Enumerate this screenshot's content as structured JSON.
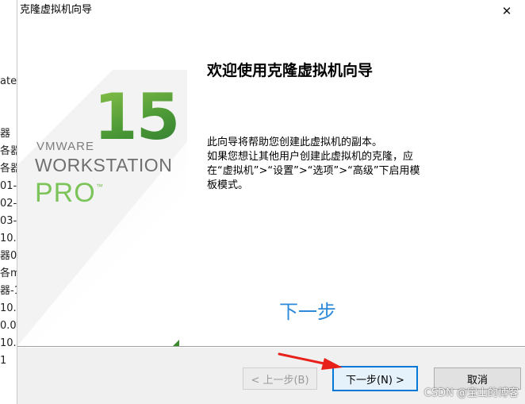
{
  "background_window": {
    "fragments": [
      "ate",
      "器",
      "各器",
      "各器",
      "01-",
      "02-",
      "03-",
      "10.",
      "器01",
      "各m",
      "器-1",
      "10.",
      "0.0.",
      "10.",
      "1"
    ]
  },
  "dialog": {
    "title": "克隆虚拟机向导",
    "close_icon": "✕"
  },
  "banner": {
    "version": "15",
    "brand": "VMWARE",
    "product": "WORKSTATION",
    "edition": "PRO",
    "trademark": "™"
  },
  "content": {
    "heading": "欢迎使用克隆虚拟机向导",
    "line1": "此向导将帮助您创建此虚拟机的副本。",
    "line2": "如果您想让其他用户创建此虚拟机的克隆，应在“虚拟机”>“设置”>“选项”>“高级”下启用模板模式。",
    "annotation": "下一步"
  },
  "footer": {
    "back_label": "< 上一步(B)",
    "next_label": "下一步(N) >",
    "cancel_label": "取消"
  },
  "watermark": "CSDN @宝山的博客",
  "colors": {
    "accent_green": "#5aa43c",
    "annotation_blue": "#2d8ad8",
    "arrow_red": "#e8201a",
    "default_button_border": "#0078d7"
  }
}
